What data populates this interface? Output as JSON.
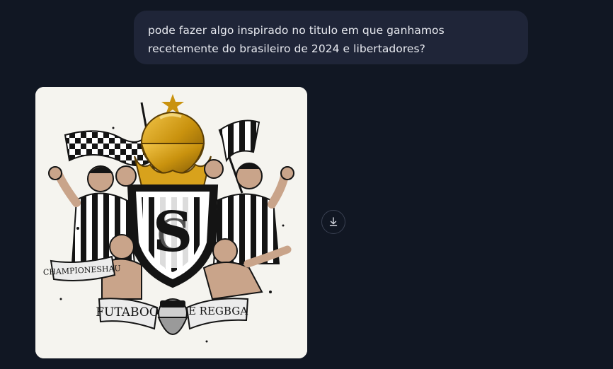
{
  "conversation": {
    "user_message": "pode fazer algo inspirado no titulo em que ganhamos recetemente do brasileiro de 2024 e libertadores?",
    "image": {
      "ribbon_left": "CHAMPIONESHAU",
      "ribbon_bottom_left": "FUTABOO",
      "ribbon_bottom_right": "E REGBGA",
      "palette": {
        "background": "#f5f4ef",
        "gold": "#c9920e",
        "black": "#141414",
        "white": "#ffffff"
      }
    },
    "actions": {
      "download_icon": "download-icon"
    }
  }
}
